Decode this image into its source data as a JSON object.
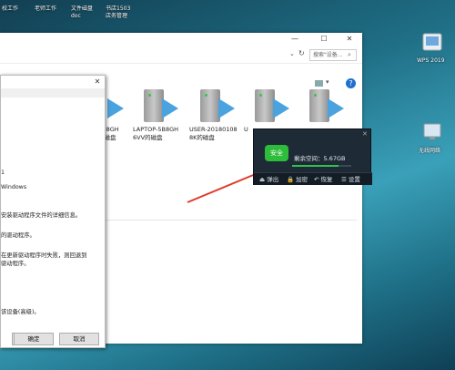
{
  "desktop": {
    "top_icons": [
      "校工作",
      "老师工作",
      "文件磁盘\ndoc",
      "书店1503\n店务管理"
    ],
    "right_icons": [
      "WPS 2019",
      "无线网络"
    ]
  },
  "explorer": {
    "search_placeholder": "搜索\"设备...",
    "drives": [
      {
        "label": "5B8GH\n的磁盘"
      },
      {
        "label": "LAPTOP-5B8GH\n6VV的磁盘"
      },
      {
        "label": "USER-20180108\n8K的磁盘"
      },
      {
        "label": "U"
      },
      {
        "label": ""
      }
    ]
  },
  "dialog": {
    "texts": [
      "1",
      "Windows",
      "安装驱动程序文件的详细信息。",
      "的驱动程序。",
      "在更新驱动程序时失败，则回退到",
      "驱动程序。",
      "该设备(高级)。"
    ],
    "ok_label": "确定",
    "cancel_label": "取消"
  },
  "popup": {
    "badge": "安全",
    "free_space": "剩余空间：5.67GB",
    "progress": 0.78,
    "actions": [
      "弹出",
      "加密",
      "恢复",
      "设置"
    ]
  },
  "colors": {
    "accent_green": "#2dbd3a",
    "arrow_red": "#e03a2e",
    "popup_bg": "#1e2a36"
  }
}
